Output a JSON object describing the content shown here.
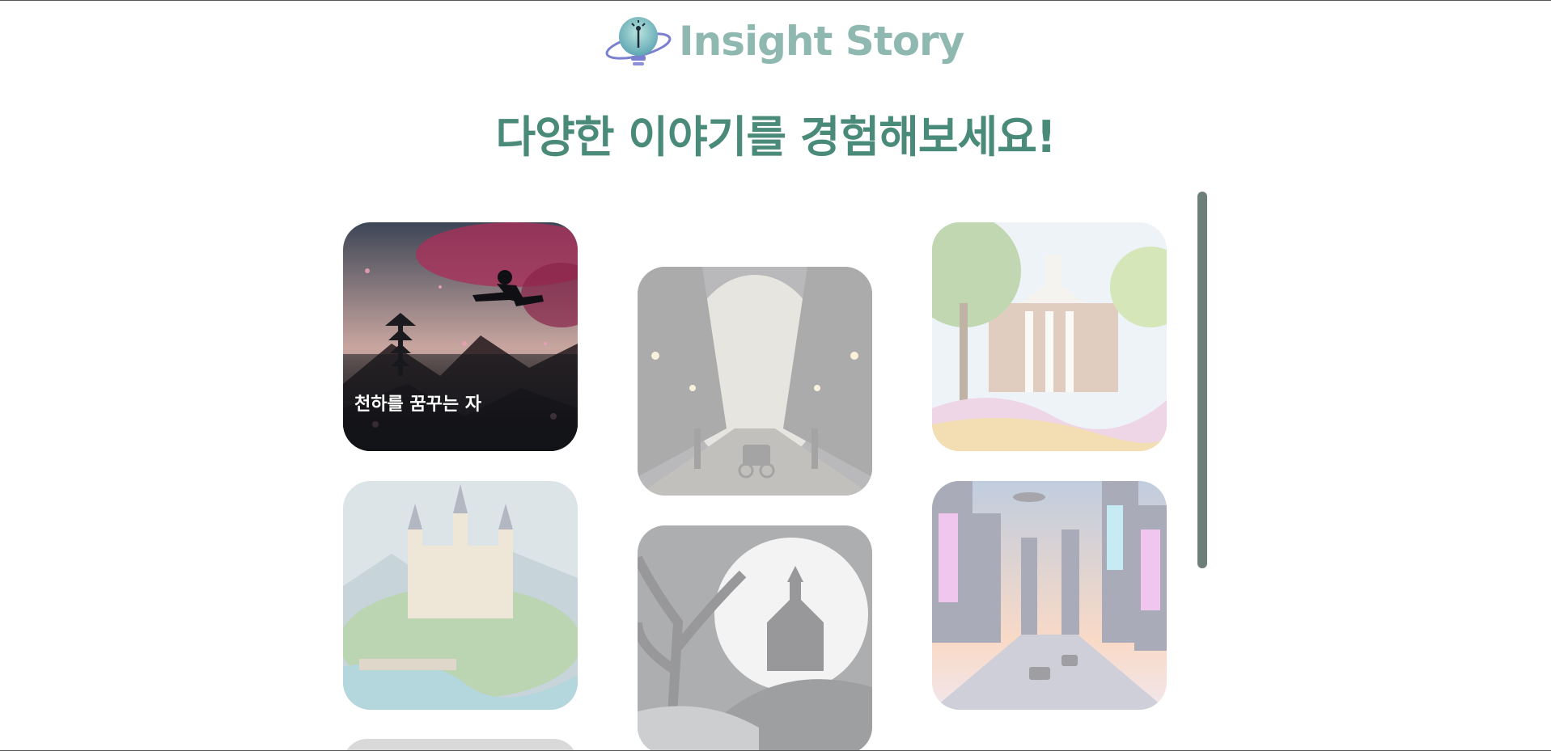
{
  "header": {
    "brand": "Insight Story",
    "logo_icon": "lightbulb-planet-icon"
  },
  "main": {
    "title": "다양한 이야기를 경험해보세요!",
    "stories": [
      {
        "label": "천하를 꿈꾸는 자",
        "theme": "martial-arts-cherry-blossom",
        "active": true
      },
      {
        "label": "",
        "theme": "victorian-street",
        "active": false
      },
      {
        "label": "",
        "theme": "academy-campus",
        "active": false
      },
      {
        "label": "",
        "theme": "fantasy-castle",
        "active": false
      },
      {
        "label": "",
        "theme": "haunted-house-moon",
        "active": false
      },
      {
        "label": "",
        "theme": "future-city",
        "active": false
      }
    ]
  },
  "colors": {
    "brand_text": "#8fb8b0",
    "title_text": "#4a8a78",
    "scrollbar": "#6e7f7a"
  }
}
